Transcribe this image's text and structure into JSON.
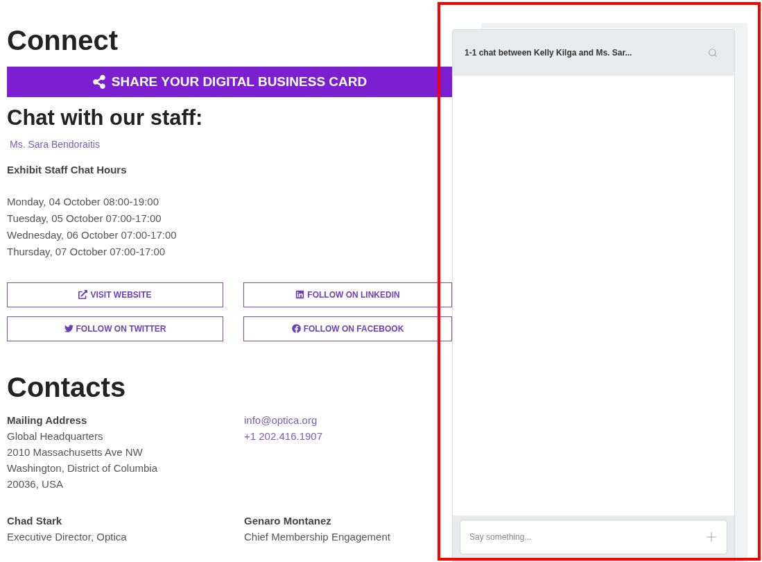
{
  "connect": {
    "title": "Connect",
    "share_button": "SHARE YOUR DIGITAL BUSINESS CARD"
  },
  "staff_chat": {
    "title": "Chat with our staff:",
    "staff": [
      "Ms. Sara Bendoraitis"
    ],
    "hours_title": "Exhibit Staff Chat Hours",
    "hours": [
      "Monday, 04 October 08:00-19:00",
      "Tuesday, 05 October 07:00-17:00",
      "Wednesday, 06 October 07:00-17:00",
      "Thursday, 07 October 07:00-17:00"
    ]
  },
  "links": [
    {
      "kind": "website",
      "label": "VISIT WEBSITE"
    },
    {
      "kind": "linkedin",
      "label": "FOLLOW ON LINKEDIN"
    },
    {
      "kind": "twitter",
      "label": "FOLLOW ON TWITTER"
    },
    {
      "kind": "facebook",
      "label": "FOLLOW ON FACEBOOK"
    }
  ],
  "contacts": {
    "title": "Contacts",
    "address_title": "Mailing Address",
    "address_lines": [
      "Global Headquarters",
      "2010 Massachusetts Ave NW",
      "Washington, District of Columbia",
      "20036, USA"
    ],
    "email": "info@optica.org",
    "phone": "+1 202.416.1907",
    "people": [
      {
        "name": "Chad Stark",
        "role": "Executive Director, Optica"
      },
      {
        "name": "Genaro Montanez",
        "role": "Chief Membership Engagement"
      }
    ]
  },
  "chat_panel": {
    "title": "1-1 chat between Kelly Kilga and Ms. Sar...",
    "input": {
      "placeholder": "Say something..."
    }
  }
}
